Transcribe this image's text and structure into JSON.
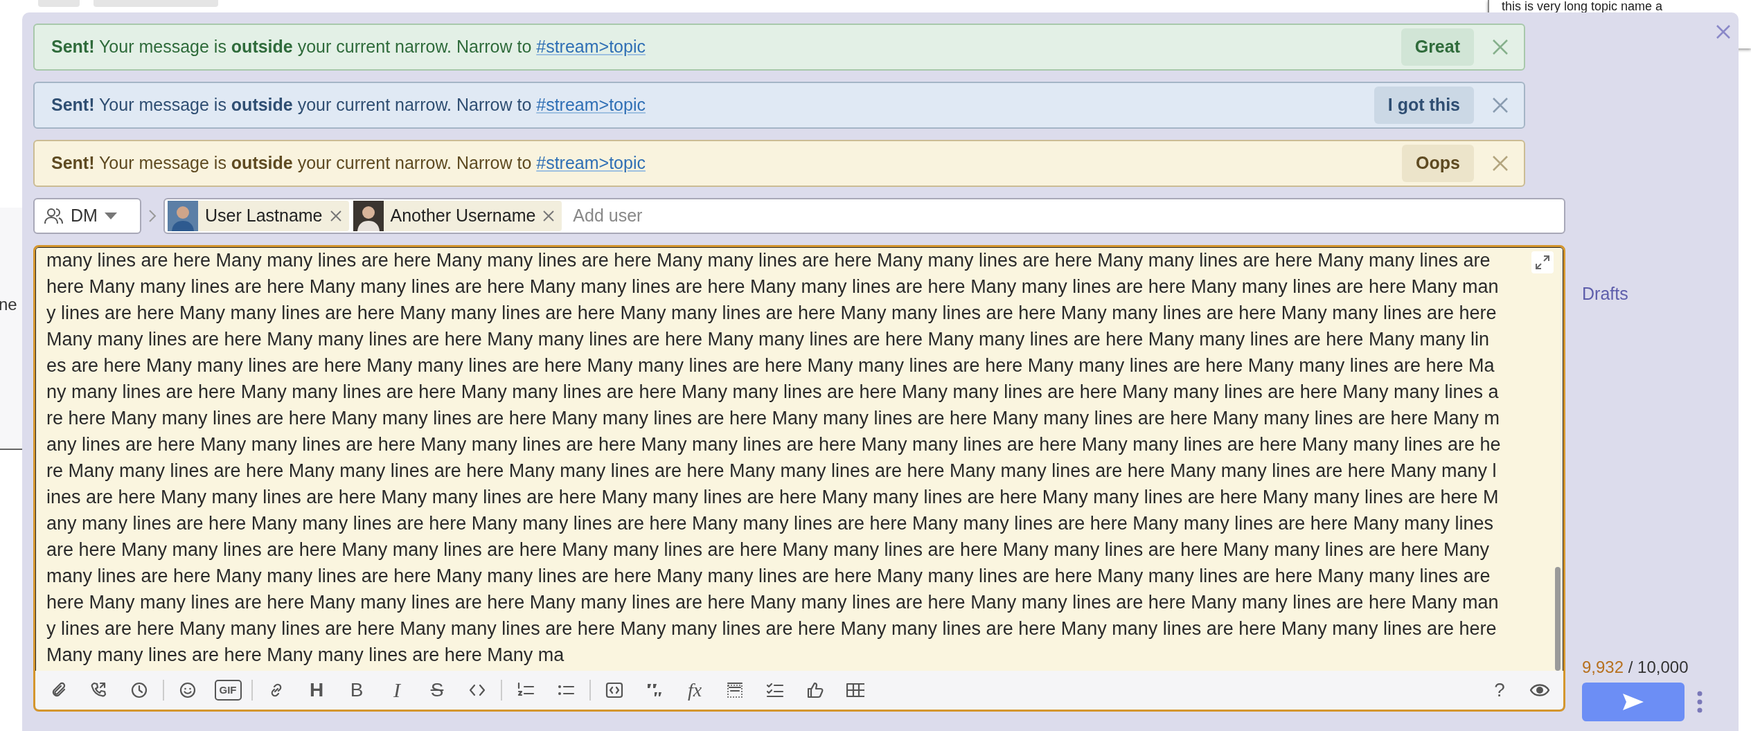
{
  "background": {
    "topic_snippet": "this is very long topic name a",
    "left_snippet": "ne"
  },
  "banners": [
    {
      "kind": "success",
      "message": "**Sent!** Your message is **outside** your current narrow. Narrow to",
      "link": "#stream>topic",
      "action": "Great"
    },
    {
      "kind": "info",
      "message": "**Sent!** Your message is **outside** your current narrow. Narrow to",
      "link": "#stream>topic",
      "action": "I got this"
    },
    {
      "kind": "warning",
      "message": "**Sent!** Your message is **outside** your current narrow. Narrow to",
      "link": "#stream>topic",
      "action": "Oops"
    }
  ],
  "recipient": {
    "type_label": "DM",
    "pills": [
      {
        "name": "User Lastname"
      },
      {
        "name": "Another Username"
      }
    ],
    "placeholder": "Add user"
  },
  "message_lines": [
    "many lines are here Many many lines are here Many many lines are here Many many lines are here Many many lines are here Many many lines are here Many many lines are",
    "here Many many lines are here Many many lines are here Many many lines are here Many many lines are here Many many lines are here Many many lines are here Many man",
    "y lines are here Many many lines are here Many many lines are here Many many lines are here Many many lines are here Many many lines are here Many many lines are here",
    "Many many lines are here Many many lines are here Many many lines are here Many many lines are here Many many lines are here Many many lines are here Many many lin",
    "es are here Many many lines are here Many many lines are here Many many lines are here Many many lines are here Many many lines are here Many many lines are here Ma",
    "ny many lines are here Many many lines are here Many many lines are here Many many lines are here Many many lines are here Many many lines are here Many many lines a",
    "re here Many many lines are here Many many lines are here Many many lines are here Many many lines are here Many many lines are here Many many lines are here Many m",
    "any lines are here Many many lines are here Many many lines are here Many many lines are here Many many lines are here Many many lines are here Many many lines are he",
    "re Many many lines are here Many many lines are here Many many lines are here Many many lines are here Many many lines are here Many many lines are here Many many l",
    "ines are here Many many lines are here Many many lines are here Many many lines are here Many many lines are here Many many lines are here Many many lines are here M",
    "any many lines are here Many many lines are here Many many lines are here Many many lines are here Many many lines are here Many many lines are here Many many lines",
    "are here Many many lines are here Many many lines are here Many many lines are here Many many lines are here Many many lines are here Many many lines are here Many",
    "many lines are here Many many lines are here Many many lines are here Many many lines are here Many many lines are here Many many lines are here Many many lines are",
    "here Many many lines are here Many many lines are here Many many lines are here Many many lines are here Many many lines are here Many many lines are here Many man",
    "y lines are here Many many lines are here Many many lines are here Many many lines are here Many many lines are here Many many lines are here Many many lines are here",
    "Many many lines are here Many many lines are here Many ma"
  ],
  "toolbar": [
    {
      "kind": "attach"
    },
    {
      "kind": "call"
    },
    {
      "kind": "clock"
    },
    {
      "kind": "divider"
    },
    {
      "kind": "emoji"
    },
    {
      "kind": "gif",
      "label": "GIF"
    },
    {
      "kind": "divider"
    },
    {
      "kind": "link"
    },
    {
      "kind": "heading",
      "label": "H"
    },
    {
      "kind": "bold",
      "label": "B"
    },
    {
      "kind": "italic",
      "label": "I"
    },
    {
      "kind": "strike",
      "label": "S"
    },
    {
      "kind": "code"
    },
    {
      "kind": "divider"
    },
    {
      "kind": "ordered"
    },
    {
      "kind": "bullets"
    },
    {
      "kind": "divider"
    },
    {
      "kind": "codeblock"
    },
    {
      "kind": "quote"
    },
    {
      "kind": "math",
      "label": "fx"
    },
    {
      "kind": "spoiler"
    },
    {
      "kind": "checklist"
    },
    {
      "kind": "poll"
    },
    {
      "kind": "table"
    }
  ],
  "toolbar_right": [
    {
      "kind": "help",
      "label": "?"
    },
    {
      "kind": "preview"
    }
  ],
  "drafts_label": "Drafts",
  "counter": {
    "count": "9,932",
    "limit": "/ 10,000"
  }
}
